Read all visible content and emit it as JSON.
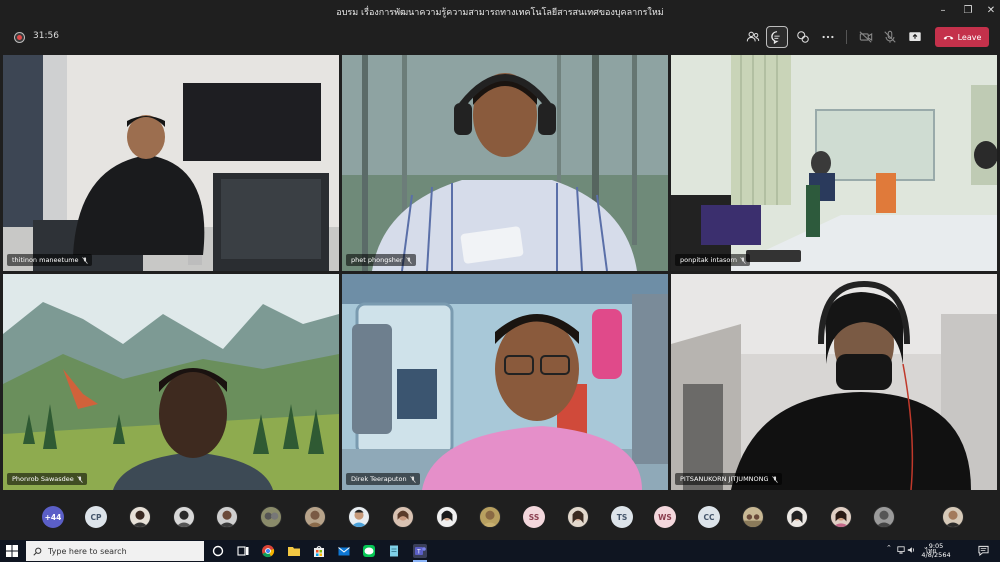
{
  "window": {
    "title": "อบรม เรื่องการพัฒนาความรู้ความสามารถทางเทคโนโลยีสารสนเทศของบุคลากรใหม่",
    "minimize_icon": "minimize-icon",
    "maximize_icon": "restore-icon",
    "close_icon": "close-icon"
  },
  "toolbar": {
    "timer": "31:56",
    "leave_label": "Leave",
    "buttons": [
      "people-icon",
      "chat-icon",
      "share-tray-icon",
      "more-icon",
      "camera-off-icon",
      "mic-off-icon",
      "share-screen-icon"
    ]
  },
  "participants": [
    {
      "name": "thitinon maneetume"
    },
    {
      "name": "phet phongsher"
    },
    {
      "name": "ponpitak intasorn"
    },
    {
      "name": "Phonrob Sawasdee"
    },
    {
      "name": "Direk Teeraputon"
    },
    {
      "name": "PITSANUKORN JITJUMNONG"
    }
  ],
  "strip": {
    "overflow_count": "+44",
    "initials": [
      "CP",
      "SS",
      "TS",
      "WS",
      "CC"
    ]
  },
  "taskbar": {
    "search_placeholder": "Type here to search",
    "language": "ไทย",
    "time": "9:05",
    "date": "4/8/2564"
  },
  "colors": {
    "leave": "#c4314b",
    "overflow_avatar": "#5b5fc7",
    "recording": "#e04a4a"
  }
}
